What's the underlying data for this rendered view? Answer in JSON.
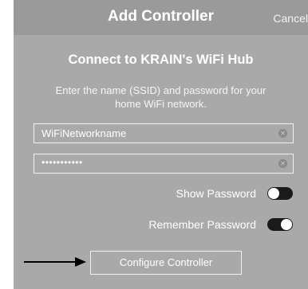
{
  "header": {
    "title": "Add Controller",
    "cancel_label": "Cancel"
  },
  "main": {
    "headline": "Connect to KRAIN's WiFi Hub",
    "instructions": "Enter the name (SSID) and password for your home WiFi network.",
    "ssid_field": {
      "value": "WiFiNetworkname",
      "clear_icon": "clear-icon"
    },
    "password_field": {
      "value": "•••••••••••",
      "clear_icon": "clear-icon"
    },
    "show_password": {
      "label": "Show Password",
      "state": "off"
    },
    "remember_password": {
      "label": "Remember Password",
      "state": "on"
    },
    "configure_button_label": "Configure Controller"
  },
  "annotation": {
    "icon": "arrow-right-icon",
    "color": "#000000"
  },
  "colors": {
    "background": "#a9a9a9",
    "header_background": "#9a9a9a",
    "toggle_track": "#1a1a1a",
    "text": "#ffffff"
  }
}
